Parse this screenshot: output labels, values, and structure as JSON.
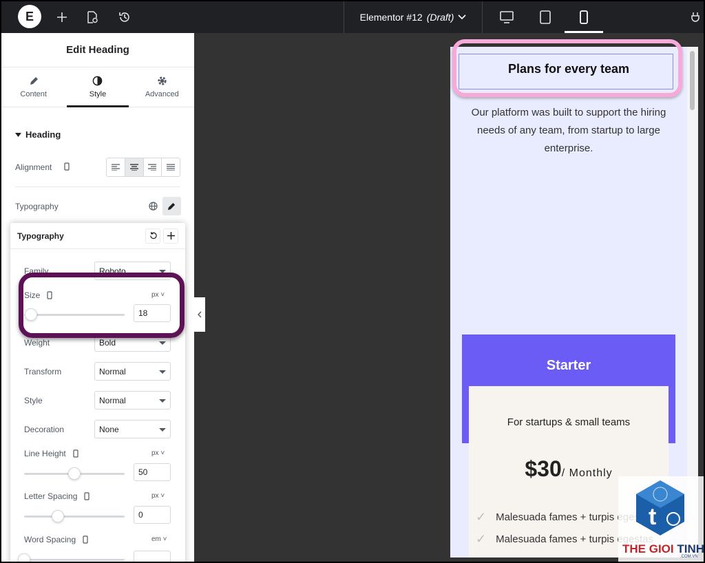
{
  "topbar": {
    "logo": "E",
    "document_title": "Elementor #12",
    "document_status": "(Draft)",
    "devices": [
      "desktop",
      "tablet",
      "mobile"
    ],
    "active_device": "mobile"
  },
  "panel": {
    "title": "Edit Heading",
    "tabs": [
      {
        "label": "Content",
        "icon": "pencil-icon"
      },
      {
        "label": "Style",
        "icon": "contrast-icon"
      },
      {
        "label": "Advanced",
        "icon": "gear-icon"
      }
    ],
    "active_tab": "Style",
    "section_title": "Heading",
    "alignment_label": "Alignment",
    "alignment_options": [
      "left",
      "center",
      "right",
      "justify"
    ],
    "alignment_selected": "center",
    "typography_label": "Typography"
  },
  "typography": {
    "title": "Typography",
    "family_label": "Family",
    "family_value": "Roboto",
    "size_label": "Size",
    "size_unit": "px",
    "size_value": "18",
    "weight_label": "Weight",
    "weight_value": "Bold",
    "transform_label": "Transform",
    "transform_value": "Normal",
    "style_label": "Style",
    "style_value": "Normal",
    "decoration_label": "Decoration",
    "decoration_value": "None",
    "line_height_label": "Line Height",
    "line_height_unit": "px",
    "line_height_value": "50",
    "letter_spacing_label": "Letter Spacing",
    "letter_spacing_unit": "px",
    "letter_spacing_value": "0",
    "word_spacing_label": "Word Spacing",
    "word_spacing_unit": "em"
  },
  "preview": {
    "heading": "Plans for every team",
    "description": "Our platform was built to support the hiring needs of any team, from startup to large enterprise.",
    "card_title": "Starter",
    "card_subtitle": "For startups & small teams",
    "price_currency": "$",
    "price_amount": "30",
    "price_period": "/ Monthly",
    "features": [
      "Malesuada fames + turpis egestas",
      "Malesuada fames + turpis egestas"
    ]
  },
  "watermark": {
    "text_a": "THE GIOI ",
    "text_b": "TINHOC",
    "sub": ".COM.VN"
  },
  "colors": {
    "accent": "#6b5cf6",
    "preview_bg": "#e9ebff",
    "highlight_size": "#5e1256",
    "highlight_heading": "#f7a9d9"
  }
}
